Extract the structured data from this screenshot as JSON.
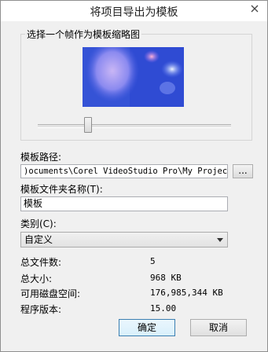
{
  "dialog": {
    "title": "将项目导出为模板",
    "close_glyph": "✕"
  },
  "thumbnail_group": {
    "label": "选择一个帧作为模板缩略图",
    "slider_position": 0.25
  },
  "template_path": {
    "label": "模板路径:",
    "value": ")ocuments\\Corel VideoStudio Pro\\My Projects",
    "browse_label": "..."
  },
  "folder_name": {
    "label": "模板文件夹名称(T):",
    "value": "模板"
  },
  "category": {
    "label": "类别(C):",
    "selected": "自定义"
  },
  "info": [
    {
      "label": "总文件数:",
      "value": "5"
    },
    {
      "label": "总大小:",
      "value": "968 KB"
    },
    {
      "label": "可用磁盘空间:",
      "value": "176,985,344 KB"
    },
    {
      "label": "程序版本:",
      "value": "15.00"
    }
  ],
  "buttons": {
    "ok": "确定",
    "cancel": "取消"
  }
}
